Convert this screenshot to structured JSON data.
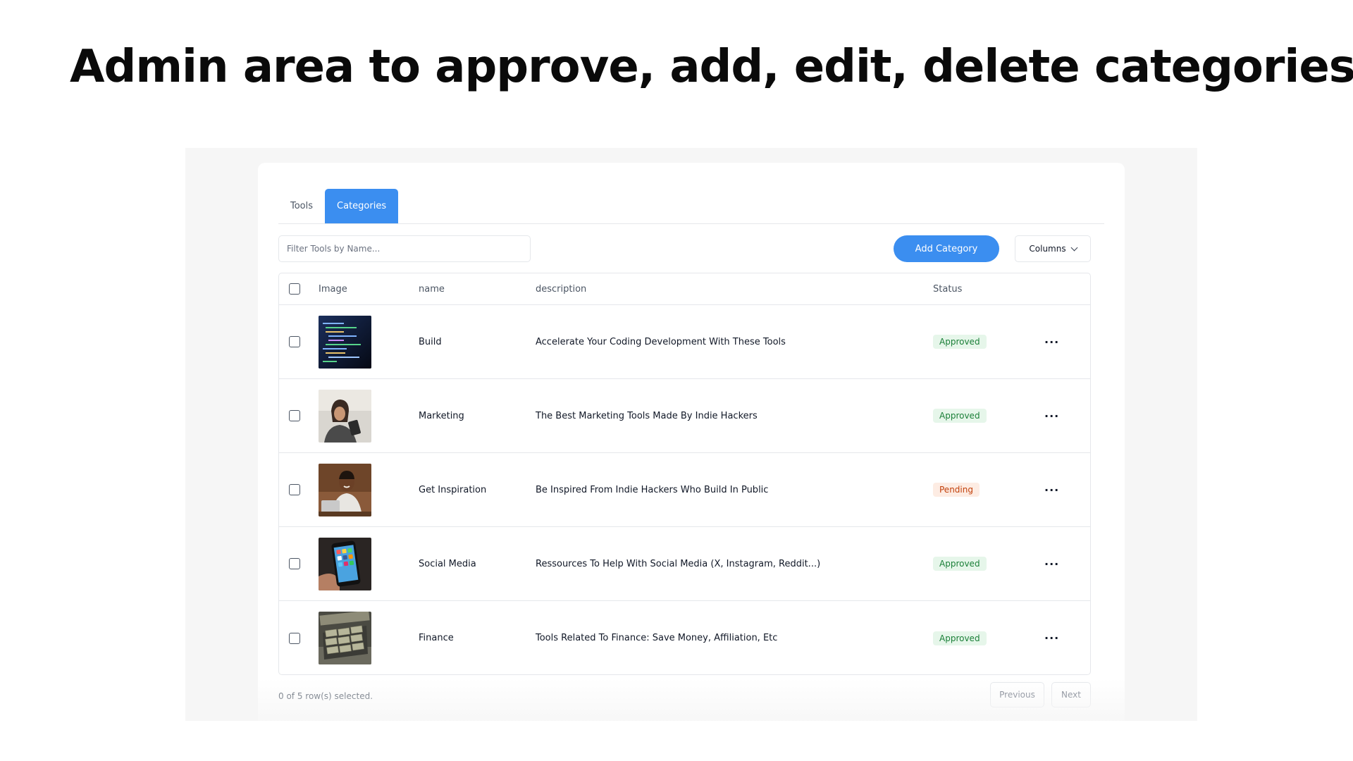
{
  "headline": "Admin area to approve, add, edit, delete categories",
  "tabs": [
    {
      "label": "Tools",
      "active": false
    },
    {
      "label": "Categories",
      "active": true
    }
  ],
  "filter": {
    "placeholder": "Filter Tools by Name...",
    "value": ""
  },
  "toolbar": {
    "add_label": "Add Category",
    "columns_label": "Columns"
  },
  "table": {
    "headers": {
      "image": "Image",
      "name": "name",
      "description": "description",
      "status": "Status"
    },
    "rows": [
      {
        "image": "code-screen-photo",
        "name": "Build",
        "description": "Accelerate Your Coding Development With These Tools",
        "status": "Approved"
      },
      {
        "image": "woman-phone-photo",
        "name": "Marketing",
        "description": "The Best Marketing Tools Made By Indie Hackers",
        "status": "Approved"
      },
      {
        "image": "man-laptop-photo",
        "name": "Get Inspiration",
        "description": "Be Inspired From Indie Hackers Who Build In Public",
        "status": "Pending"
      },
      {
        "image": "smartphone-apps-photo",
        "name": "Social Media",
        "description": "Ressources To Help With Social Media (X, Instagram, Reddit...)",
        "status": "Approved"
      },
      {
        "image": "money-case-photo",
        "name": "Finance",
        "description": "Tools Related To Finance: Save Money, Affiliation, Etc",
        "status": "Approved"
      }
    ],
    "row_menu_icon": "more-horizontal-icon"
  },
  "footer": {
    "selection_text": "0 of 5 row(s) selected.",
    "previous_label": "Previous",
    "next_label": "Next"
  },
  "colors": {
    "accent": "#3b8ef0",
    "approved_bg": "#e6f6ea",
    "approved_text": "#1a7f37",
    "pending_bg": "#fdece3",
    "pending_text": "#c2410c"
  }
}
